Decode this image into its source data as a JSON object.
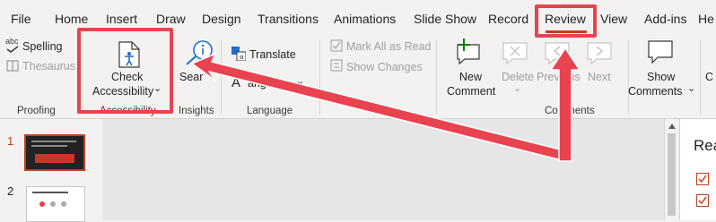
{
  "tabs": [
    "File",
    "Home",
    "Insert",
    "Draw",
    "Design",
    "Transitions",
    "Animations",
    "Slide Show",
    "Record",
    "Review",
    "View",
    "Add-ins",
    "He"
  ],
  "active_tab": "Review",
  "proofing": {
    "spelling": "Spelling",
    "spelling_abc": "abc",
    "thesaurus": "Thesaurus",
    "group": "Proofing"
  },
  "accessibility": {
    "line1": "Check",
    "line2": "Accessibility",
    "chevron": "⌄",
    "group": "Accessibility"
  },
  "insights": {
    "search": "Sear",
    "group": "Insights"
  },
  "language": {
    "translate": "Translate",
    "language_partial": "anguage",
    "chevron": "⌄",
    "group": "Language"
  },
  "activity": {
    "mark_all": "Mark All as Read",
    "show_changes": "Show Changes",
    "group": "ivity"
  },
  "comments": {
    "new1": "New",
    "new2": "Comment",
    "delete": "Delete",
    "delete_chevron": "⌄",
    "previous": "Previous",
    "next": "Next",
    "show1": "Show",
    "show2": "Comments",
    "show_chevron": "⌄",
    "group": "Comments",
    "more": "C"
  },
  "slides": [
    {
      "number": "1"
    },
    {
      "number": "2"
    }
  ],
  "right_pane": {
    "title": "Rea"
  },
  "annotation_color": "#e8434f"
}
